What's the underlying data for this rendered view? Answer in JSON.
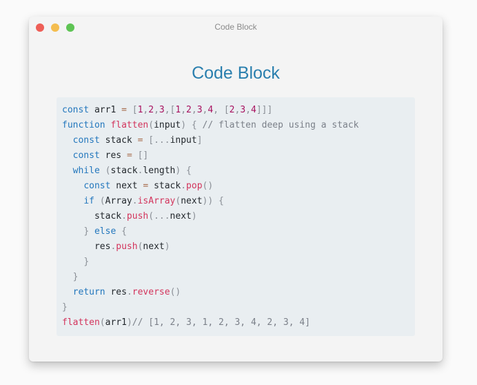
{
  "window": {
    "title": "Code Block",
    "buttons": {
      "close_color": "#ee5f57",
      "minimize_color": "#f4bd4f",
      "maximize_color": "#5ec454"
    }
  },
  "heading": "Code Block",
  "colors": {
    "heading": "#2a7fae",
    "code_background": "#e9eef1",
    "keyword": "#2377bd",
    "function": "#d3345c",
    "number": "#a8125f",
    "punctuation": "#8a8f96",
    "comment": "#7b8089"
  },
  "code": {
    "language": "javascript",
    "lines": [
      [
        {
          "t": "kw",
          "v": "const"
        },
        {
          "t": "var",
          "v": " arr1 "
        },
        {
          "t": "op",
          "v": "="
        },
        {
          "t": "var",
          "v": " "
        },
        {
          "t": "punc",
          "v": "["
        },
        {
          "t": "num",
          "v": "1"
        },
        {
          "t": "punc",
          "v": ","
        },
        {
          "t": "num",
          "v": "2"
        },
        {
          "t": "punc",
          "v": ","
        },
        {
          "t": "num",
          "v": "3"
        },
        {
          "t": "punc",
          "v": ",["
        },
        {
          "t": "num",
          "v": "1"
        },
        {
          "t": "punc",
          "v": ","
        },
        {
          "t": "num",
          "v": "2"
        },
        {
          "t": "punc",
          "v": ","
        },
        {
          "t": "num",
          "v": "3"
        },
        {
          "t": "punc",
          "v": ","
        },
        {
          "t": "num",
          "v": "4"
        },
        {
          "t": "punc",
          "v": ","
        },
        {
          "t": "var",
          "v": " "
        },
        {
          "t": "punc",
          "v": "["
        },
        {
          "t": "num",
          "v": "2"
        },
        {
          "t": "punc",
          "v": ","
        },
        {
          "t": "num",
          "v": "3"
        },
        {
          "t": "punc",
          "v": ","
        },
        {
          "t": "num",
          "v": "4"
        },
        {
          "t": "punc",
          "v": "]]]"
        }
      ],
      [
        {
          "t": "kw",
          "v": "function"
        },
        {
          "t": "var",
          "v": " "
        },
        {
          "t": "fn",
          "v": "flatten"
        },
        {
          "t": "punc",
          "v": "("
        },
        {
          "t": "var",
          "v": "input"
        },
        {
          "t": "punc",
          "v": ")"
        },
        {
          "t": "var",
          "v": " "
        },
        {
          "t": "punc",
          "v": "{"
        },
        {
          "t": "var",
          "v": " "
        },
        {
          "t": "cm",
          "v": "// flatten deep using a stack"
        }
      ],
      [
        {
          "t": "var",
          "v": "  "
        },
        {
          "t": "kw",
          "v": "const"
        },
        {
          "t": "var",
          "v": " stack "
        },
        {
          "t": "op",
          "v": "="
        },
        {
          "t": "var",
          "v": " "
        },
        {
          "t": "punc",
          "v": "[..."
        },
        {
          "t": "var",
          "v": "input"
        },
        {
          "t": "punc",
          "v": "]"
        }
      ],
      [
        {
          "t": "var",
          "v": "  "
        },
        {
          "t": "kw",
          "v": "const"
        },
        {
          "t": "var",
          "v": " res "
        },
        {
          "t": "op",
          "v": "="
        },
        {
          "t": "var",
          "v": " "
        },
        {
          "t": "punc",
          "v": "[]"
        }
      ],
      [
        {
          "t": "var",
          "v": "  "
        },
        {
          "t": "kw",
          "v": "while"
        },
        {
          "t": "var",
          "v": " "
        },
        {
          "t": "punc",
          "v": "("
        },
        {
          "t": "var",
          "v": "stack"
        },
        {
          "t": "punc",
          "v": "."
        },
        {
          "t": "var",
          "v": "length"
        },
        {
          "t": "punc",
          "v": ")"
        },
        {
          "t": "var",
          "v": " "
        },
        {
          "t": "punc",
          "v": "{"
        }
      ],
      [
        {
          "t": "var",
          "v": "    "
        },
        {
          "t": "kw",
          "v": "const"
        },
        {
          "t": "var",
          "v": " next "
        },
        {
          "t": "op",
          "v": "="
        },
        {
          "t": "var",
          "v": " stack"
        },
        {
          "t": "punc",
          "v": "."
        },
        {
          "t": "fn",
          "v": "pop"
        },
        {
          "t": "punc",
          "v": "()"
        }
      ],
      [
        {
          "t": "var",
          "v": "    "
        },
        {
          "t": "kw",
          "v": "if"
        },
        {
          "t": "var",
          "v": " "
        },
        {
          "t": "punc",
          "v": "("
        },
        {
          "t": "var",
          "v": "Array"
        },
        {
          "t": "punc",
          "v": "."
        },
        {
          "t": "fn",
          "v": "isArray"
        },
        {
          "t": "punc",
          "v": "("
        },
        {
          "t": "var",
          "v": "next"
        },
        {
          "t": "punc",
          "v": "))"
        },
        {
          "t": "var",
          "v": " "
        },
        {
          "t": "punc",
          "v": "{"
        }
      ],
      [
        {
          "t": "var",
          "v": "      stack"
        },
        {
          "t": "punc",
          "v": "."
        },
        {
          "t": "fn",
          "v": "push"
        },
        {
          "t": "punc",
          "v": "(..."
        },
        {
          "t": "var",
          "v": "next"
        },
        {
          "t": "punc",
          "v": ")"
        }
      ],
      [
        {
          "t": "var",
          "v": "    "
        },
        {
          "t": "punc",
          "v": "}"
        },
        {
          "t": "var",
          "v": " "
        },
        {
          "t": "kw",
          "v": "else"
        },
        {
          "t": "var",
          "v": " "
        },
        {
          "t": "punc",
          "v": "{"
        }
      ],
      [
        {
          "t": "var",
          "v": "      res"
        },
        {
          "t": "punc",
          "v": "."
        },
        {
          "t": "fn",
          "v": "push"
        },
        {
          "t": "punc",
          "v": "("
        },
        {
          "t": "var",
          "v": "next"
        },
        {
          "t": "punc",
          "v": ")"
        }
      ],
      [
        {
          "t": "var",
          "v": "    "
        },
        {
          "t": "punc",
          "v": "}"
        }
      ],
      [
        {
          "t": "var",
          "v": "  "
        },
        {
          "t": "punc",
          "v": "}"
        }
      ],
      [
        {
          "t": "var",
          "v": "  "
        },
        {
          "t": "kw",
          "v": "return"
        },
        {
          "t": "var",
          "v": " res"
        },
        {
          "t": "punc",
          "v": "."
        },
        {
          "t": "fn",
          "v": "reverse"
        },
        {
          "t": "punc",
          "v": "()"
        }
      ],
      [
        {
          "t": "punc",
          "v": "}"
        }
      ],
      [
        {
          "t": "fn",
          "v": "flatten"
        },
        {
          "t": "punc",
          "v": "("
        },
        {
          "t": "var",
          "v": "arr1"
        },
        {
          "t": "punc",
          "v": ")"
        },
        {
          "t": "cm",
          "v": "// [1, 2, 3, 1, 2, 3, 4, 2, 3, 4]"
        }
      ]
    ]
  }
}
